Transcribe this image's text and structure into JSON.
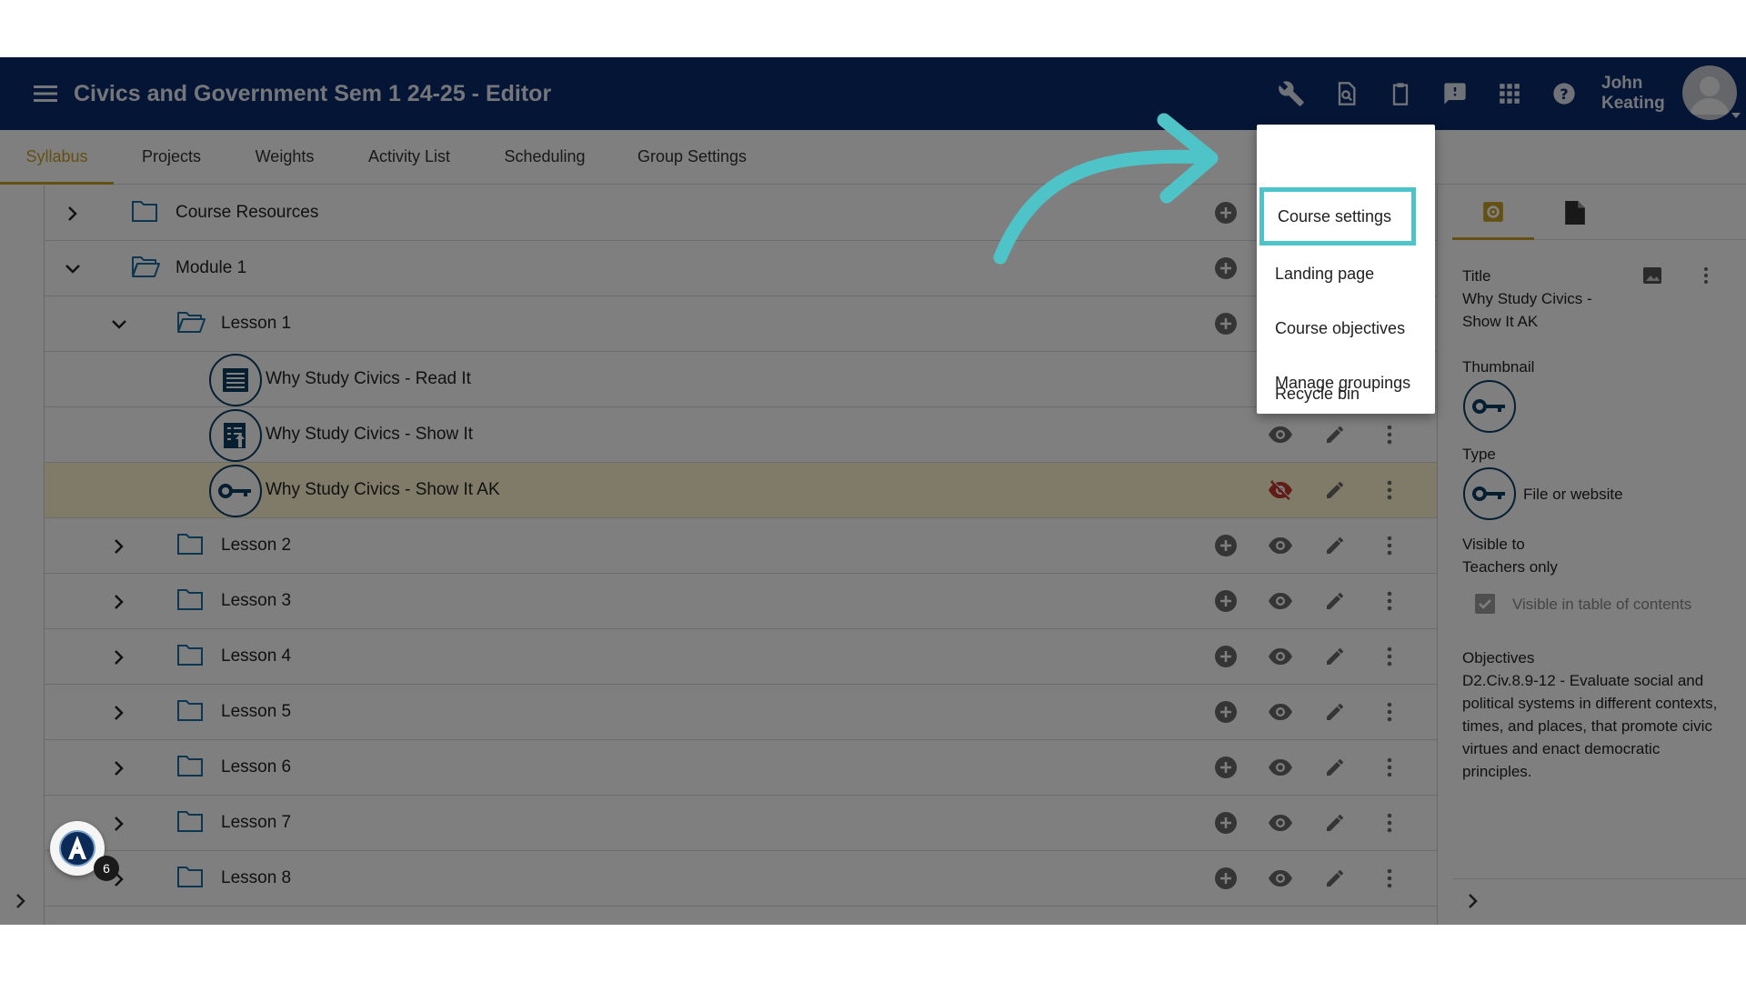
{
  "header": {
    "title": "Civics and Government Sem 1 24-25 - Editor",
    "user_first": "John",
    "user_last": "Keating",
    "icons": [
      "wrench-icon",
      "search-document-icon",
      "clipboard-icon",
      "feedback-icon",
      "apps-grid-icon",
      "help-icon"
    ]
  },
  "tabs": [
    {
      "label": "Syllabus",
      "active": true
    },
    {
      "label": "Projects"
    },
    {
      "label": "Weights"
    },
    {
      "label": "Activity List"
    },
    {
      "label": "Scheduling"
    },
    {
      "label": "Group Settings"
    }
  ],
  "tree": {
    "rows": [
      {
        "label": "Course Resources",
        "type": "folder",
        "expanded": false
      },
      {
        "label": "Module 1",
        "type": "folder",
        "expanded": true
      },
      {
        "label": "Lesson 1",
        "type": "folder",
        "expanded": true
      },
      {
        "label": "Why Study Civics - Read It",
        "type": "reading"
      },
      {
        "label": "Why Study Civics - Show It",
        "type": "assignment"
      },
      {
        "label": "Why Study Civics - Show It AK",
        "type": "link",
        "selected": true,
        "hidden": true
      },
      {
        "label": "Lesson 2",
        "type": "folder"
      },
      {
        "label": "Lesson 3",
        "type": "folder"
      },
      {
        "label": "Lesson 4",
        "type": "folder"
      },
      {
        "label": "Lesson 5",
        "type": "folder"
      },
      {
        "label": "Lesson 6",
        "type": "folder"
      },
      {
        "label": "Lesson 7",
        "type": "folder"
      },
      {
        "label": "Lesson 8",
        "type": "folder"
      }
    ]
  },
  "menu": {
    "items": [
      "Course settings",
      "Landing page",
      "Course objectives",
      "Manage groupings",
      "Recycle bin"
    ],
    "highlighted": "Course settings"
  },
  "panel": {
    "title_label": "Title",
    "title_value_1": "Why Study Civics -",
    "title_value_2": "Show It AK",
    "thumbnail_label": "Thumbnail",
    "type_label": "Type",
    "type_value": "File or website",
    "visible_label": "Visible to",
    "visible_value": "Teachers only",
    "toc_label": "Visible in table of contents",
    "objectives_label": "Objectives",
    "objectives_lines": [
      "D2.Civ.8.9-12 - Evaluate social and",
      "political systems in different contexts,",
      "times, and places, that promote civic",
      "virtues and enact democratic",
      "principles."
    ]
  },
  "badge_count": "6",
  "colors": {
    "header_bg": "#0a2a6b",
    "accent_gold": "#c9a125",
    "highlight_teal": "#4fc4c8",
    "icon_navy": "#0b3e63"
  }
}
